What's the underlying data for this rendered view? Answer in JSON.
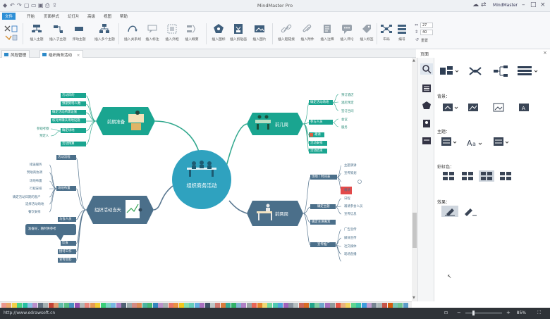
{
  "window": {
    "title": "MindMaster Pro",
    "user": "MindMaster"
  },
  "menu": [
    "文件",
    "开始",
    "页面样式",
    "幻灯片",
    "高级",
    "视图",
    "帮助"
  ],
  "ribbon": {
    "buttons": [
      "插入主题",
      "插入子主题",
      "浮动主题",
      "插入多个主题",
      "插入关系线",
      "插入标注",
      "插入外框",
      "插入概要",
      "插入图标",
      "插入剪贴画",
      "插入图片",
      "插入超链接",
      "插入附件",
      "插入注释",
      "插入评论",
      "插入标签",
      "布局",
      "编号",
      "重置"
    ],
    "spin1": "27",
    "spin2": "40"
  },
  "tabs": [
    {
      "label": "风险管理"
    },
    {
      "label": "组织商务活动"
    }
  ],
  "map": {
    "center": "组织商务活动",
    "branches": {
      "left_top": "前期准备",
      "left_bottom": "组织活动当天",
      "right_top": "前几周",
      "right_bottom": "前两周"
    },
    "left_top_items": [
      "活动目的",
      "预期到场人数",
      "确定活动所需设施",
      "核对并确认场地设施",
      "确定场地",
      "活动预算"
    ],
    "left_top_sub": [
      "参观考察",
      "预定人"
    ],
    "left_bottom_items": [
      "活动流程",
      "场地布置",
      "与会人员",
      "饮食",
      "接待工作",
      "宣传资料"
    ],
    "left_bottom_sub": [
      "接送服务",
      "赞助商协调",
      "场地布置",
      "行程安排",
      "确定活动日期的客户",
      "选择活动场地",
      "餐饮安排"
    ],
    "left_note": "准备好，随时供参考",
    "right_top_items": [
      "确定活动场地",
      "参与人员",
      "邀请",
      "活动安排",
      "活动结束"
    ],
    "right_top_sub": [
      "预订酒店",
      "酒店预定",
      "签订合同",
      "会议",
      "服务"
    ],
    "right_bottom_items": [
      "场地 / 时间表",
      "确定主题",
      "确定主讲嘉宾",
      "宣传推广"
    ],
    "right_bottom_sub": [
      "主题演讲",
      "宣传策划",
      "嘉宾",
      "邀请",
      "日程",
      "邀请参会人员",
      "宣传信息",
      "广告宣传",
      "媒体宣传",
      "社交媒体",
      "现场直播"
    ]
  },
  "panel": {
    "title": "页面",
    "sections": [
      "背景：",
      "主题：",
      "彩虹色："
    ],
    "sec4": "效果："
  },
  "status": {
    "link": "http://www.edrawsoft.cn",
    "zoom": "85%"
  },
  "colors": {
    "accent": "#2e8fd6",
    "teal": "#1aa590",
    "slate": "#4b6f8a",
    "center": "#2fa2bf",
    "line_teal": "#32a88e",
    "line_slate": "#5a7891"
  }
}
